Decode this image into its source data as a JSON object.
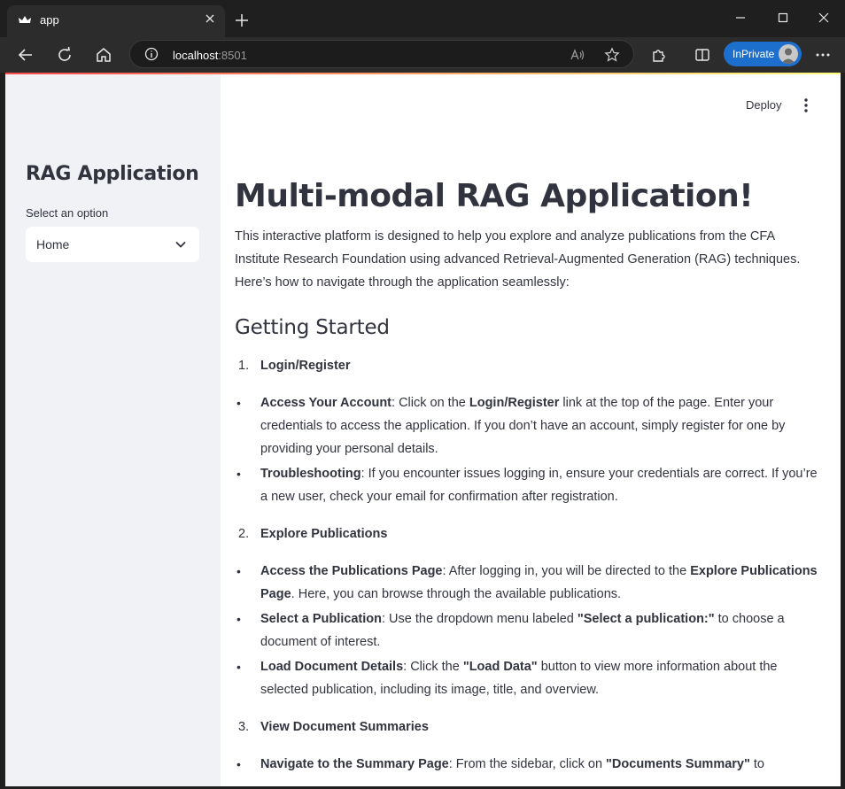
{
  "browser": {
    "tab_title": "app",
    "url_host": "localhost",
    "url_port": ":8501",
    "inprivate_label": "InPrivate"
  },
  "app": {
    "header": {
      "deploy_label": "Deploy"
    },
    "sidebar": {
      "title": "RAG Application",
      "select_label": "Select an option",
      "select_value": "Home"
    },
    "main": {
      "title": "Multi-modal RAG Application!",
      "intro": "This interactive platform is designed to help you explore and analyze publications from the CFA Institute Research Foundation using advanced Retrieval-Augmented Generation (RAG) techniques. Here’s how to navigate through the application seamlessly:",
      "section_heading": "Getting Started",
      "step1": {
        "number": "1.",
        "title": "Login/Register",
        "bullets": [
          {
            "bold": "Access Your Account",
            "t1": ": Click on the ",
            "bold2": "Login/Register",
            "t2": " link at the top of the page. Enter your credentials to access the application. If you don’t have an account, simply register for one by providing your personal details."
          },
          {
            "bold": "Troubleshooting",
            "t1": ": If you encounter issues logging in, ensure your credentials are correct. If you’re a new user, check your email for confirmation after registration."
          }
        ]
      },
      "step2": {
        "number": "2.",
        "title": "Explore Publications",
        "bullets": [
          {
            "bold": "Access the Publications Page",
            "t1": ": After logging in, you will be directed to the ",
            "bold2": "Explore Publications Page",
            "t2": ". Here, you can browse through the available publications."
          },
          {
            "bold": "Select a Publication",
            "t1": ": Use the dropdown menu labeled ",
            "bold2": "\"Select a publication:\"",
            "t2": " to choose a document of interest."
          },
          {
            "bold": "Load Document Details",
            "t1": ": Click the ",
            "bold2": "\"Load Data\"",
            "t2": " button to view more information about the selected publication, including its image, title, and overview."
          }
        ]
      },
      "step3": {
        "number": "3.",
        "title": "View Document Summaries",
        "bullets": [
          {
            "bold": "Navigate to the Summary Page",
            "t1": ": From the sidebar, click on ",
            "bold2": "\"Documents Summary\"",
            "t2": " to"
          }
        ]
      }
    }
  }
}
